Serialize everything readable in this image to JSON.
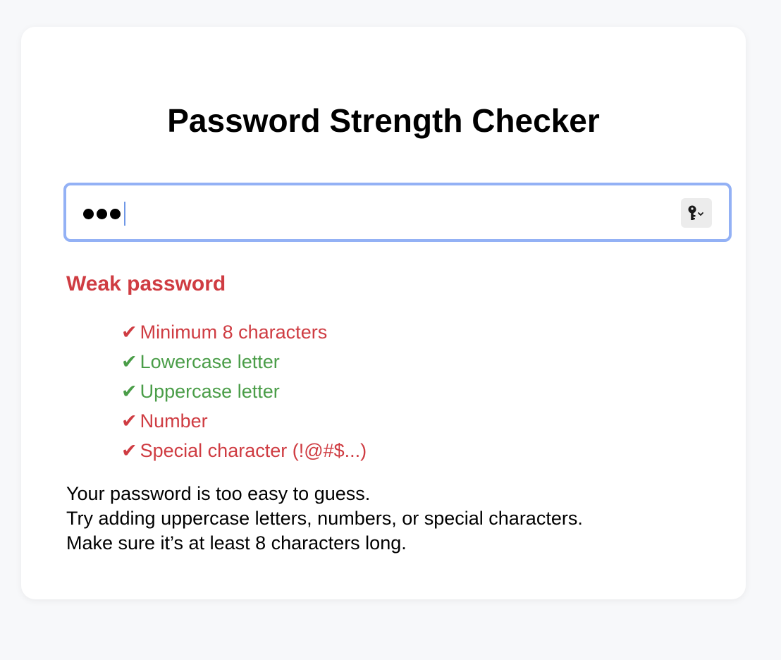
{
  "title": "Password Strength Checker",
  "password_field": {
    "masked_length": 3,
    "icon": "key-icon"
  },
  "colors": {
    "fail": "#cf3c42",
    "pass": "#4a9d48",
    "focus_border": "#93b1f5"
  },
  "status": {
    "label": "Weak password",
    "level": "weak"
  },
  "requirements": [
    {
      "check": "✔",
      "label": "Minimum 8 characters",
      "met": false
    },
    {
      "check": "✔",
      "label": "Lowercase letter",
      "met": true
    },
    {
      "check": "✔",
      "label": "Uppercase letter",
      "met": true
    },
    {
      "check": "✔",
      "label": "Number",
      "met": false
    },
    {
      "check": "✔",
      "label": "Special character (!@#$...)",
      "met": false
    }
  ],
  "message": {
    "line1": "Your password is too easy to guess.",
    "line2": "Try adding uppercase letters, numbers, or special characters.",
    "line3": "Make sure it’s at least 8 characters long."
  }
}
